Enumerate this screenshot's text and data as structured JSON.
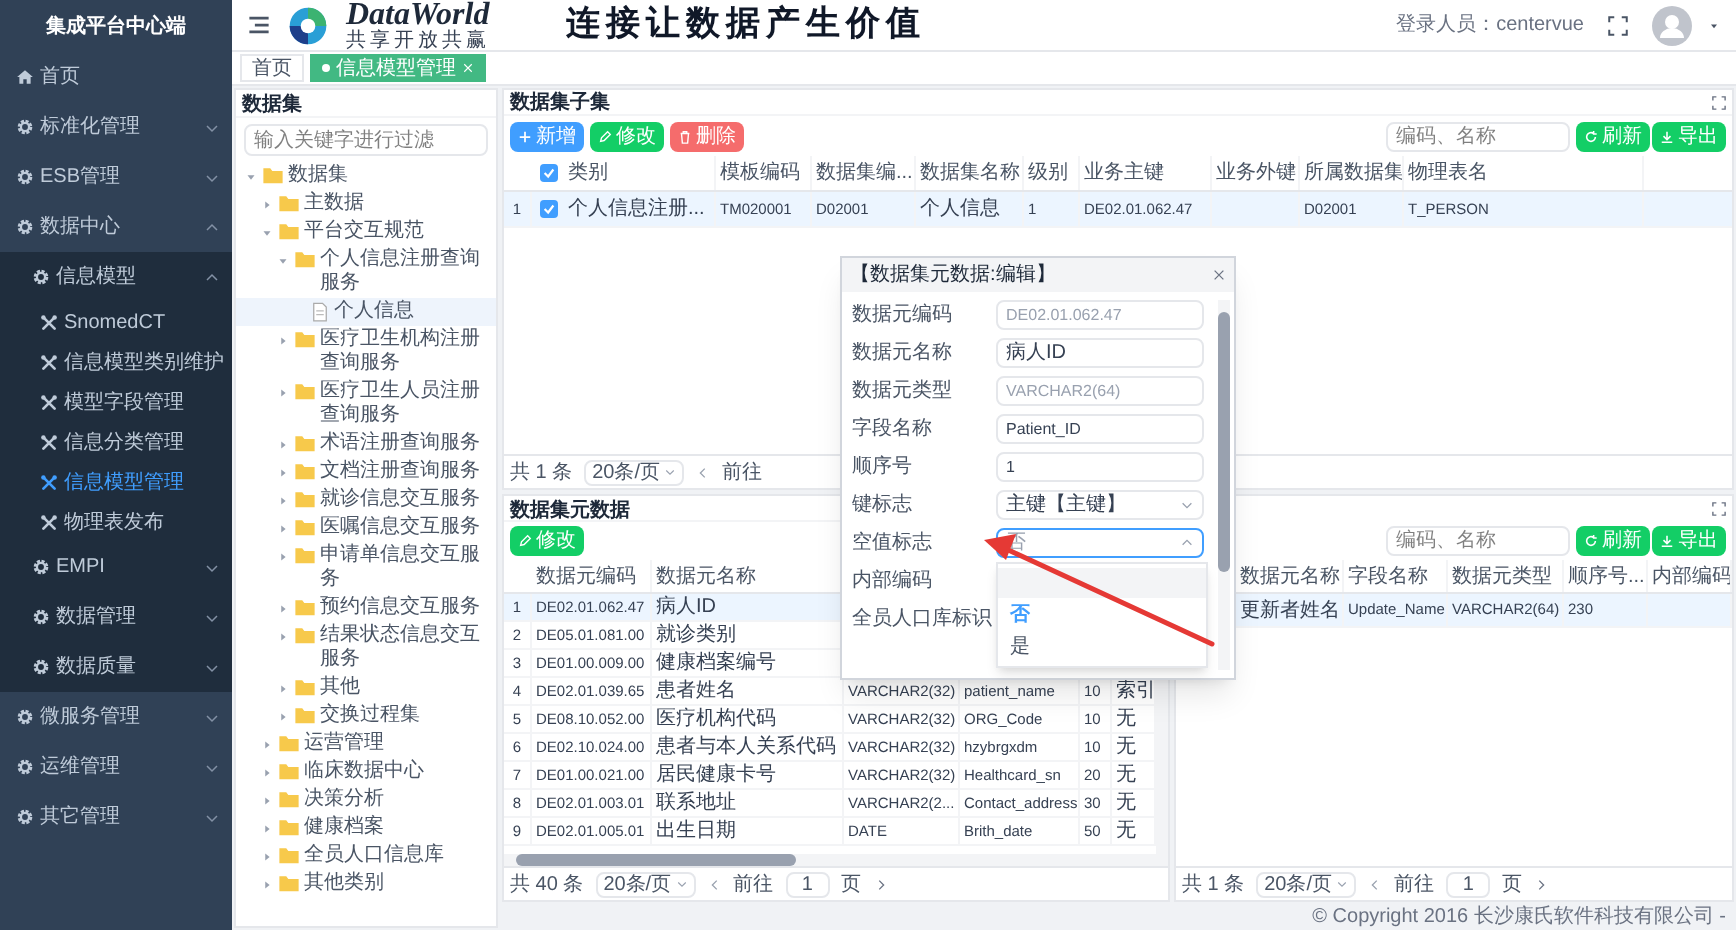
{
  "sidebar": {
    "title": "集成平台中心端",
    "items": [
      {
        "label": "首页",
        "selected": false
      },
      {
        "label": "标准化管理",
        "expanded": false,
        "selected": false
      },
      {
        "label": "ESB管理",
        "expanded": false,
        "selected": false
      },
      {
        "label": "数据中心",
        "expanded": true,
        "selected": false,
        "children": [
          {
            "label": "信息模型",
            "expanded": true,
            "selected": false,
            "children": [
              {
                "label": "SnomedCT",
                "selected": false
              },
              {
                "label": "信息模型类别维护",
                "selected": false
              },
              {
                "label": "模型字段管理",
                "selected": false
              },
              {
                "label": "信息分类管理",
                "selected": false
              },
              {
                "label": "信息模型管理",
                "selected": true
              },
              {
                "label": "物理表发布",
                "selected": false
              }
            ]
          },
          {
            "label": "EMPI",
            "expanded": false,
            "selected": false
          },
          {
            "label": "数据管理",
            "expanded": false,
            "selected": false
          },
          {
            "label": "数据质量",
            "expanded": false,
            "selected": false
          }
        ]
      },
      {
        "label": "微服务管理",
        "expanded": false,
        "selected": false
      },
      {
        "label": "运维管理",
        "expanded": false,
        "selected": false
      },
      {
        "label": "其它管理",
        "expanded": false,
        "selected": false
      }
    ]
  },
  "header": {
    "logo_text": "DataWorld",
    "logo_subtitle": "共享开放共赢",
    "slogan": "连接让数据产生价值",
    "user_label": "登录人员：centervue"
  },
  "tabs": [
    {
      "label": "首页",
      "selected": false
    },
    {
      "label": "信息模型管理",
      "selected": true
    }
  ],
  "tree": {
    "title": "数据集",
    "search": {
      "placeholder": "输入关键字进行过滤"
    },
    "nodes": [
      {
        "label": "数据集",
        "expanded": true,
        "selected": false,
        "children": [
          {
            "label": "主数据",
            "expanded": false,
            "selected": false
          },
          {
            "label": "平台交互规范",
            "expanded": true,
            "selected": false,
            "children": [
              {
                "label": "个人信息注册查询服务",
                "expanded": true,
                "selected": false,
                "children": [
                  {
                    "label": "个人信息",
                    "selected": true
                  }
                ]
              },
              {
                "label": "医疗卫生机构注册查询服务",
                "expanded": false,
                "selected": false
              },
              {
                "label": "医疗卫生人员注册查询服务",
                "expanded": false,
                "selected": false
              },
              {
                "label": "术语注册查询服务",
                "expanded": false,
                "selected": false
              },
              {
                "label": "文档注册查询服务",
                "expanded": false,
                "selected": false
              },
              {
                "label": "就诊信息交互服务",
                "expanded": false,
                "selected": false
              },
              {
                "label": "医嘱信息交互服务",
                "expanded": false,
                "selected": false
              },
              {
                "label": "申请单信息交互服务",
                "expanded": false,
                "selected": false
              },
              {
                "label": "预约信息交互服务",
                "expanded": false,
                "selected": false
              },
              {
                "label": "结果状态信息交互服务",
                "expanded": false,
                "selected": false
              },
              {
                "label": "其他",
                "expanded": false,
                "selected": false
              },
              {
                "label": "交换过程集",
                "expanded": false,
                "selected": false
              }
            ]
          },
          {
            "label": "运营管理",
            "expanded": false,
            "selected": false
          },
          {
            "label": "临床数据中心",
            "expanded": false,
            "selected": false
          },
          {
            "label": "决策分析",
            "expanded": false,
            "selected": false
          },
          {
            "label": "健康档案",
            "expanded": false,
            "selected": false
          },
          {
            "label": "全员人口信息库",
            "expanded": false,
            "selected": false
          },
          {
            "label": "其他类别",
            "expanded": false,
            "selected": false
          }
        ]
      }
    ]
  },
  "subset_panel": {
    "title": "数据集子集",
    "buttons": [
      {
        "label": "新增",
        "kind": "add"
      },
      {
        "label": "修改",
        "kind": "edit"
      },
      {
        "label": "删除",
        "kind": "delete"
      }
    ],
    "search": {
      "placeholder": "编码、名称"
    },
    "actions": [
      {
        "label": "刷新",
        "kind": "refresh"
      },
      {
        "label": "导出",
        "kind": "export"
      }
    ],
    "table": {
      "all_checked": true,
      "columns": [
        "类别",
        "模板编码",
        "数据集编...",
        "数据集名称",
        "级别",
        "业务主键",
        "业务外键",
        "所属数据集",
        "物理表名"
      ],
      "rows": [
        {
          "index": "1",
          "checked": true,
          "selected": true,
          "cells": [
            "个人信息注册...",
            "TM020001",
            "D02001",
            "个人信息",
            "1",
            "DE02.01.062.47",
            null,
            "D02001",
            "T_PERSON"
          ]
        }
      ]
    },
    "pagination": {
      "total": "共 1 条",
      "page_size": "20条/页",
      "goto": "前往"
    }
  },
  "element_panel": {
    "title": "数据集元数据",
    "buttons": [
      {
        "label": "修改",
        "kind": "edit"
      }
    ],
    "table": {
      "columns": [
        "数据元编码",
        "数据元名称"
      ],
      "rows": [
        {
          "index": "1",
          "selected": true,
          "cells": [
            "DE02.01.062.47",
            "病人ID"
          ]
        },
        {
          "index": "2",
          "selected": false,
          "cells": [
            "DE05.01.081.00",
            "就诊类别"
          ]
        },
        {
          "index": "3",
          "selected": false,
          "cells": [
            "DE01.00.009.00",
            "健康档案编号"
          ]
        },
        {
          "index": "4",
          "selected": false,
          "cells": [
            "DE02.01.039.65",
            "患者姓名",
            "VARCHAR2(32)",
            "patient_name",
            "10",
            "索引"
          ]
        },
        {
          "index": "5",
          "selected": false,
          "cells": [
            "DE08.10.052.00",
            "医疗机构代码",
            "VARCHAR2(32)",
            "ORG_Code",
            "10",
            "无"
          ]
        },
        {
          "index": "6",
          "selected": false,
          "cells": [
            "DE02.10.024.00",
            "患者与本人关系代码",
            "VARCHAR2(32)",
            "hzybrgxdm",
            "10",
            "无"
          ]
        },
        {
          "index": "7",
          "selected": false,
          "cells": [
            "DE01.00.021.00",
            "居民健康卡号",
            "VARCHAR2(32)",
            "Healthcard_sn",
            "20",
            "无"
          ]
        },
        {
          "index": "8",
          "selected": false,
          "cells": [
            "DE02.01.003.01",
            "联系地址",
            "VARCHAR2(2...",
            "Contact_address",
            "30",
            "无"
          ]
        },
        {
          "index": "9",
          "selected": false,
          "cells": [
            "DE02.01.005.01",
            "出生日期",
            "DATE",
            "Brith_date",
            "50",
            "无"
          ]
        }
      ]
    },
    "pagination": {
      "total": "共 40 条",
      "page_size": "20条/页",
      "goto": "前往",
      "page": "1",
      "unit": "页"
    }
  },
  "update_panel": {
    "search": {
      "placeholder": "编码、名称"
    },
    "actions": [
      {
        "label": "刷新",
        "kind": "refresh"
      },
      {
        "label": "导出",
        "kind": "export"
      }
    ],
    "table": {
      "columns": [
        "数据元名称",
        "字段名称",
        "数据元类型",
        "顺序号...",
        "内部编码"
      ],
      "rows": [
        {
          "selected": true,
          "cells": [
            "更新者姓名",
            "Update_Name",
            "VARCHAR2(64)",
            "230",
            null
          ]
        }
      ]
    },
    "pagination": {
      "total": "共 1 条",
      "page_size": "20条/页",
      "goto": "前往",
      "page": "1",
      "unit": "页"
    }
  },
  "modal": {
    "title": "【数据集元数据:编辑】",
    "fields": [
      {
        "label": "数据元编码",
        "kind": "input",
        "value": "DE02.01.062.47",
        "disabled": true
      },
      {
        "label": "数据元名称",
        "kind": "input",
        "value": "病人ID",
        "disabled": false
      },
      {
        "label": "数据元类型",
        "kind": "input",
        "value": "VARCHAR2(64)",
        "disabled": true
      },
      {
        "label": "字段名称",
        "kind": "input",
        "value": "Patient_ID",
        "disabled": false
      },
      {
        "label": "顺序号",
        "kind": "input",
        "value": "1",
        "disabled": false
      },
      {
        "label": "键标志",
        "kind": "select",
        "value": "主键【主键】",
        "open": false
      },
      {
        "label": "空值标志",
        "kind": "select",
        "value": "否",
        "open": true,
        "options": [
          {
            "label": "否",
            "selected": true
          },
          {
            "label": "是",
            "selected": false
          }
        ]
      },
      {
        "label": "内部编码",
        "kind": "covered"
      },
      {
        "label": "全员人口库标识",
        "kind": "covered"
      }
    ]
  },
  "footer": {
    "copyright": "© Copyright 2016 长沙康氏软件科技有限公司 -"
  }
}
